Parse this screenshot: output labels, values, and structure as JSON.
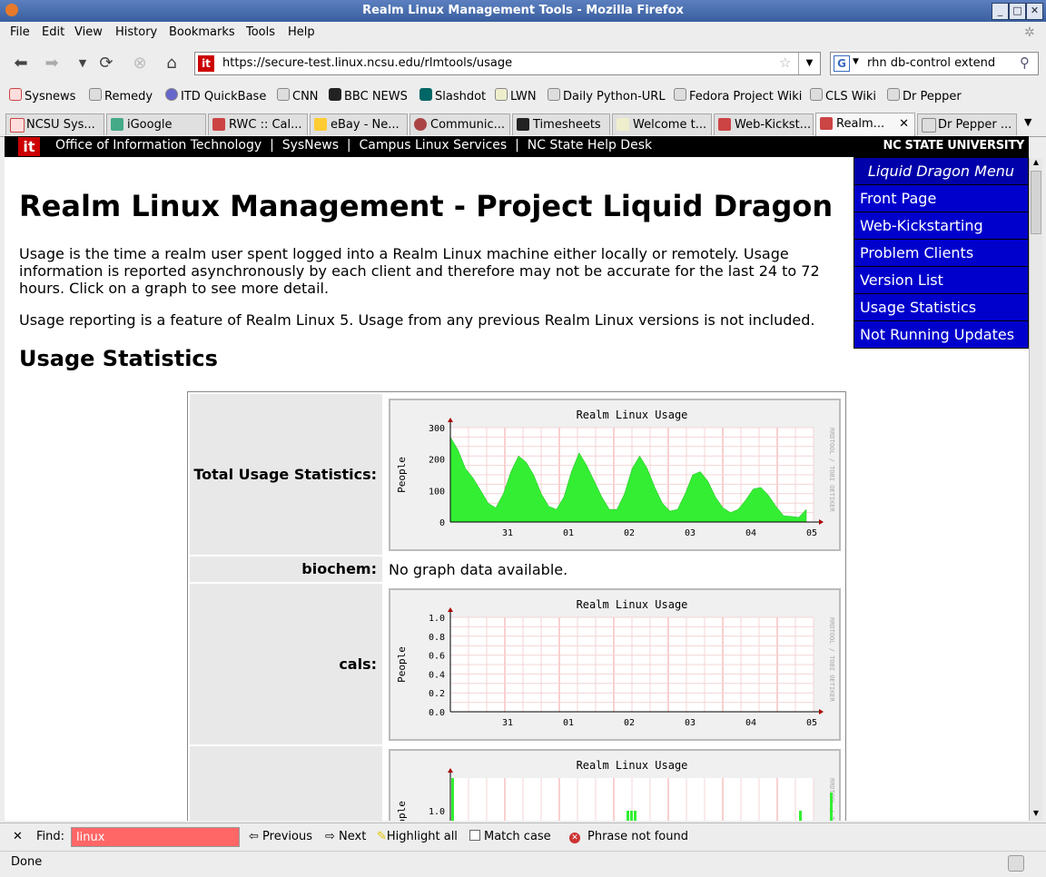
{
  "window": {
    "title": "Realm Linux Management Tools - Mozilla Firefox"
  },
  "menubar": [
    "File",
    "Edit",
    "View",
    "History",
    "Bookmarks",
    "Tools",
    "Help"
  ],
  "nav": {
    "url": "https://secure-test.linux.ncsu.edu/rlmtools/usage",
    "search_query": "rhn db-control extend",
    "site_icon": "it"
  },
  "bookmarks": [
    "Sysnews",
    "Remedy",
    "ITD QuickBase",
    "CNN",
    "BBC NEWS",
    "Slashdot",
    "LWN",
    "Daily Python-URL",
    "Fedora Project Wiki",
    "CLS Wiki",
    "Dr Pepper"
  ],
  "tabs": [
    "NCSU Sys...",
    "iGoogle",
    "RWC :: Cal...",
    "eBay - Ne...",
    "Communic...",
    "Timesheets",
    "Welcome t...",
    "Web-Kickst...",
    "Realm...",
    "Dr Pepper ..."
  ],
  "active_tab_index": 8,
  "page": {
    "header_links": "Office of Information Technology  |  SysNews  |  Campus Linux Services  |  NC State Help Desk",
    "logo": "it",
    "ncsu": "NC STATE UNIVERSITY",
    "menu_title": "Liquid Dragon Menu",
    "menu_items": [
      "Front Page",
      "Web-Kickstarting",
      "Problem Clients",
      "Version List",
      "Usage Statistics",
      "Not Running Updates"
    ],
    "title": "Realm Linux Management - Project Liquid Dragon",
    "para1": "Usage is the time a realm user spent logged into a Realm Linux machine either locally or remotely. Usage information is reported asynchronously by each client and therefore may not be accurate for the last 24 to 72 hours. Click on a graph to see more detail.",
    "para2": "Usage reporting is a feature of Realm Linux 5. Usage from any previous Realm Linux versions is not included.",
    "section_title": "Usage Statistics",
    "rows": [
      {
        "label": "Total Usage Statistics:"
      },
      {
        "label": "biochem:",
        "text": "No graph data available."
      },
      {
        "label": "cals:"
      }
    ]
  },
  "chart_data": [
    {
      "type": "area",
      "title": "Realm Linux Usage",
      "ylabel": "People",
      "side_label": "RRDTOOL / TOBI OETIKER",
      "ylim": [
        0,
        300
      ],
      "yticks": [
        "0",
        "100",
        "200",
        "300"
      ],
      "xticks": [
        "31",
        "01",
        "02",
        "03",
        "04",
        "05"
      ],
      "series_color": "#33ee33",
      "values": [
        270,
        230,
        170,
        140,
        100,
        60,
        45,
        90,
        160,
        210,
        190,
        150,
        90,
        50,
        40,
        80,
        160,
        220,
        180,
        130,
        80,
        40,
        40,
        90,
        170,
        210,
        170,
        110,
        60,
        35,
        40,
        90,
        150,
        160,
        130,
        80,
        45,
        30,
        40,
        70,
        105,
        110,
        85,
        50,
        20,
        18,
        15,
        40
      ]
    },
    {
      "type": "area",
      "title": "Realm Linux Usage",
      "ylabel": "People",
      "side_label": "RRDTOOL / TOBI OETIKER",
      "ylim": [
        0,
        1.0
      ],
      "yticks": [
        "0.0",
        "0.2",
        "0.4",
        "0.6",
        "0.8",
        "1.0"
      ],
      "xticks": [
        "31",
        "01",
        "02",
        "03",
        "04",
        "05"
      ],
      "series_color": "#33ee33",
      "values": []
    },
    {
      "type": "bar",
      "title": "Realm Linux Usage",
      "ylabel": "People",
      "side_label": "RRDTOOL / TOBI",
      "yticks": [
        "1.0"
      ],
      "series_color": "#33ee33"
    }
  ],
  "findbar": {
    "find_label": "Find:",
    "query": "linux",
    "previous": "Previous",
    "next": "Next",
    "highlight_all": "Highlight all",
    "match_case": "Match case",
    "status": "Phrase not found"
  },
  "status": "Done"
}
